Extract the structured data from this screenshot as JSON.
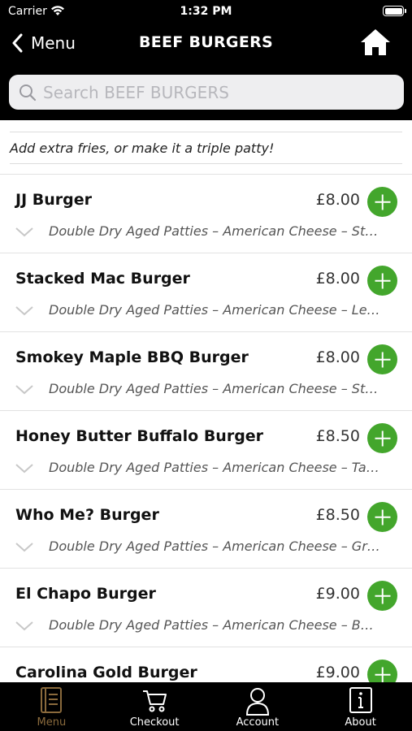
{
  "status_bar": {
    "carrier": "Carrier",
    "time": "1:32 PM"
  },
  "nav": {
    "back_label": "Menu",
    "title": "BEEF BURGERS",
    "home_icon": "home-icon"
  },
  "search": {
    "placeholder": "Search BEEF BURGERS",
    "value": ""
  },
  "promo_text": "Add extra fries, or make it a triple patty!",
  "items": [
    {
      "name": "JJ Burger",
      "price": "£8.00",
      "description": "Double Dry Aged Patties – American Cheese – St…"
    },
    {
      "name": "Stacked Mac Burger",
      "price": "£8.00",
      "description": "Double Dry Aged Patties – American Cheese – Le…"
    },
    {
      "name": "Smokey Maple BBQ Burger",
      "price": "£8.00",
      "description": "Double Dry Aged Patties – American Cheese – St…"
    },
    {
      "name": "Honey Butter Buffalo Burger",
      "price": "£8.50",
      "description": "Double Dry Aged Patties – American Cheese – Ta…"
    },
    {
      "name": "Who Me? Burger",
      "price": "£8.50",
      "description": "Double Dry Aged Patties – American Cheese – Gr…"
    },
    {
      "name": "El Chapo Burger",
      "price": "£9.00",
      "description": "Double Dry Aged Patties – American Cheese – B…"
    },
    {
      "name": "Carolina Gold Burger",
      "price": "£9.00",
      "description": ""
    }
  ],
  "tabs": [
    {
      "label": "Menu",
      "icon": "menu-book-icon",
      "active": true
    },
    {
      "label": "Checkout",
      "icon": "cart-icon",
      "active": false
    },
    {
      "label": "Account",
      "icon": "user-icon",
      "active": false
    },
    {
      "label": "About",
      "icon": "info-icon",
      "active": false
    }
  ],
  "colors": {
    "accent_green": "#43a62c",
    "active_tab": "#8a6a3c",
    "bar_bg": "#000000"
  }
}
